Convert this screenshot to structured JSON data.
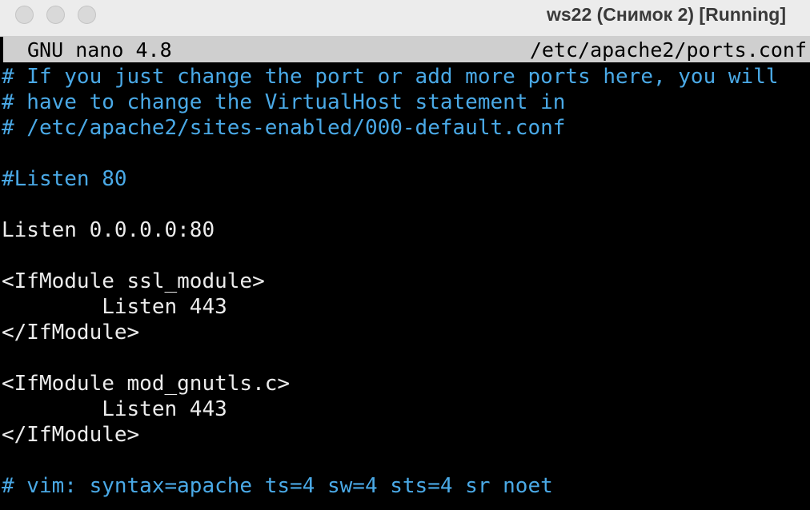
{
  "window": {
    "title": "ws22 (Снимок 2) [Running]",
    "controls": [
      "close-icon",
      "minimize-icon",
      "zoom-icon"
    ]
  },
  "nano": {
    "app": "GNU nano 4.8",
    "file": "/etc/apache2/ports.conf"
  },
  "colors": {
    "comment": "#4aa9e6",
    "text": "#ececec",
    "background": "#000000",
    "header": "#cfcfcf"
  },
  "editor": {
    "lines": [
      {
        "text": "# If you just change the port or add more ports here, you will",
        "kind": "comment"
      },
      {
        "text": "# have to change the VirtualHost statement in",
        "kind": "comment"
      },
      {
        "text": "# /etc/apache2/sites-enabled/000-default.conf",
        "kind": "comment"
      },
      {
        "text": "",
        "kind": "blank"
      },
      {
        "text": "#Listen 80",
        "kind": "comment"
      },
      {
        "text": "",
        "kind": "blank"
      },
      {
        "text": "Listen 0.0.0.0:80",
        "kind": "normal"
      },
      {
        "text": "",
        "kind": "blank"
      },
      {
        "text": "<IfModule ssl_module>",
        "kind": "normal"
      },
      {
        "text": "        Listen 443",
        "kind": "normal"
      },
      {
        "text": "</IfModule>",
        "kind": "normal"
      },
      {
        "text": "",
        "kind": "blank"
      },
      {
        "text": "<IfModule mod_gnutls.c>",
        "kind": "normal"
      },
      {
        "text": "        Listen 443",
        "kind": "normal"
      },
      {
        "text": "</IfModule>",
        "kind": "normal"
      },
      {
        "text": "",
        "kind": "blank"
      },
      {
        "text": "# vim: syntax=apache ts=4 sw=4 sts=4 sr noet",
        "kind": "comment"
      }
    ]
  }
}
